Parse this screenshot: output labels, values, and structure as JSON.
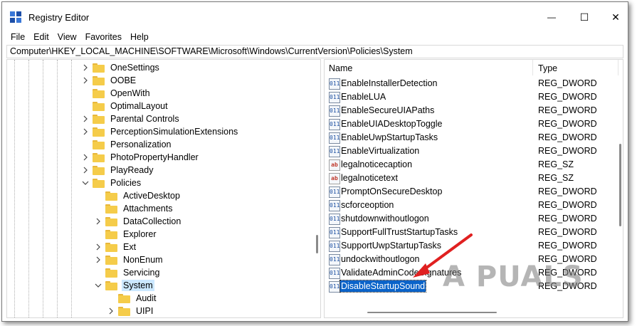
{
  "window": {
    "title": "Registry Editor",
    "minimize_glyph": "—",
    "maximize_glyph": "☐",
    "close_glyph": "✕"
  },
  "menu": [
    "File",
    "Edit",
    "View",
    "Favorites",
    "Help"
  ],
  "address": "Computer\\HKEY_LOCAL_MACHINE\\SOFTWARE\\Microsoft\\Windows\\CurrentVersion\\Policies\\System",
  "tree": [
    {
      "label": "OneSettings",
      "expander": "collapsed",
      "level": 0
    },
    {
      "label": "OOBE",
      "expander": "collapsed",
      "level": 0
    },
    {
      "label": "OpenWith",
      "expander": "none",
      "level": 0
    },
    {
      "label": "OptimalLayout",
      "expander": "none",
      "level": 0
    },
    {
      "label": "Parental Controls",
      "expander": "collapsed",
      "level": 0
    },
    {
      "label": "PerceptionSimulationExtensions",
      "expander": "collapsed",
      "level": 0
    },
    {
      "label": "Personalization",
      "expander": "none",
      "level": 0
    },
    {
      "label": "PhotoPropertyHandler",
      "expander": "collapsed",
      "level": 0
    },
    {
      "label": "PlayReady",
      "expander": "collapsed",
      "level": 0
    },
    {
      "label": "Policies",
      "expander": "expanded",
      "level": 0
    },
    {
      "label": "ActiveDesktop",
      "expander": "none",
      "level": 1
    },
    {
      "label": "Attachments",
      "expander": "none",
      "level": 1
    },
    {
      "label": "DataCollection",
      "expander": "collapsed",
      "level": 1
    },
    {
      "label": "Explorer",
      "expander": "none",
      "level": 1
    },
    {
      "label": "Ext",
      "expander": "collapsed",
      "level": 1
    },
    {
      "label": "NonEnum",
      "expander": "collapsed",
      "level": 1
    },
    {
      "label": "Servicing",
      "expander": "none",
      "level": 1
    },
    {
      "label": "System",
      "expander": "expanded",
      "level": 1,
      "selected": true
    },
    {
      "label": "Audit",
      "expander": "none",
      "level": 2
    },
    {
      "label": "UIPI",
      "expander": "collapsed",
      "level": 2
    }
  ],
  "values_header": {
    "name": "Name",
    "type": "Type"
  },
  "values": [
    {
      "name": "EnableInstallerDetection",
      "type": "REG_DWORD",
      "kind": "dword"
    },
    {
      "name": "EnableLUA",
      "type": "REG_DWORD",
      "kind": "dword"
    },
    {
      "name": "EnableSecureUIAPaths",
      "type": "REG_DWORD",
      "kind": "dword"
    },
    {
      "name": "EnableUIADesktopToggle",
      "type": "REG_DWORD",
      "kind": "dword"
    },
    {
      "name": "EnableUwpStartupTasks",
      "type": "REG_DWORD",
      "kind": "dword"
    },
    {
      "name": "EnableVirtualization",
      "type": "REG_DWORD",
      "kind": "dword"
    },
    {
      "name": "legalnoticecaption",
      "type": "REG_SZ",
      "kind": "sz"
    },
    {
      "name": "legalnoticetext",
      "type": "REG_SZ",
      "kind": "sz"
    },
    {
      "name": "PromptOnSecureDesktop",
      "type": "REG_DWORD",
      "kind": "dword"
    },
    {
      "name": "scforceoption",
      "type": "REG_DWORD",
      "kind": "dword"
    },
    {
      "name": "shutdownwithoutlogon",
      "type": "REG_DWORD",
      "kind": "dword"
    },
    {
      "name": "SupportFullTrustStartupTasks",
      "type": "REG_DWORD",
      "kind": "dword"
    },
    {
      "name": "SupportUwpStartupTasks",
      "type": "REG_DWORD",
      "kind": "dword"
    },
    {
      "name": "undockwithoutlogon",
      "type": "REG_DWORD",
      "kind": "dword"
    },
    {
      "name": "ValidateAdminCodeSignatures",
      "type": "REG_DWORD",
      "kind": "dword"
    },
    {
      "name": "DisableStartupSound",
      "type": "REG_DWORD",
      "kind": "dword",
      "selected": true
    }
  ],
  "icon_glyphs": {
    "dword": "011",
    "sz": "ab"
  },
  "watermark": "A  PUALS",
  "colors": {
    "selection": "#0a63c9",
    "tree_selection": "#cce8ff",
    "folder": "#f5cc4a",
    "arrow": "#e02020"
  }
}
